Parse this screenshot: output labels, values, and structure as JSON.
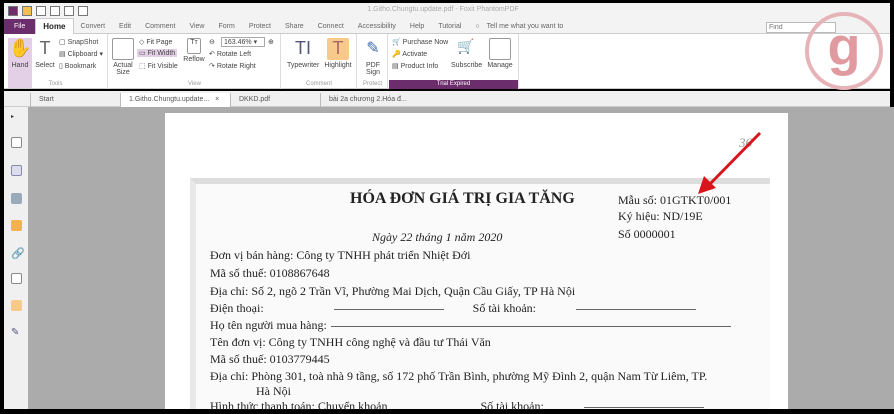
{
  "window": {
    "title": "1.Githo.Chungtu.update.pdf - Foxit PhantomPDF"
  },
  "menu": [
    "File",
    "Home",
    "Convert",
    "Edit",
    "Comment",
    "View",
    "Form",
    "Protect",
    "Share",
    "Connect",
    "Accessibility",
    "Help",
    "Tutorial"
  ],
  "tell_me": "Tell me what you want to",
  "find_placeholder": "Find",
  "ribbon": {
    "tools": {
      "hand": "Hand",
      "select": "Select",
      "snapshot": "SnapShot",
      "clipboard": "Clipboard",
      "bookmark": "Bookmark",
      "label": "Tools"
    },
    "view": {
      "actual_size": "Actual Size",
      "fit_page": "Fit Page",
      "fit_width": "Fit Width",
      "fit_visible": "Fit Visible",
      "reflow": "Reflow",
      "zoom": "163.46%",
      "rotate_left": "Rotate Left",
      "rotate_right": "Rotate Right",
      "label": "View"
    },
    "comment": {
      "typewriter": "Typewriter",
      "highlight": "Highlight",
      "label": "Comment"
    },
    "protect": {
      "pdf_sign": "PDF Sign",
      "label": "Protect"
    },
    "trial": {
      "purchase": "Purchase Now",
      "activate": "Activate",
      "product_info": "Product Info",
      "subscribe": "Subscribe",
      "manage": "Manage",
      "label": "Trial Expired"
    }
  },
  "tabs": [
    "Start",
    "1.Githo.Chungtu.update...",
    "DKKD.pdf",
    "bài 2a chương 2.Hóa đ..."
  ],
  "doc": {
    "page_mark": "36",
    "title": "HÓA ĐƠN GIÁ TRỊ GIA TĂNG",
    "mau_so": "Mẫu số: 01GTKT0/001",
    "ky_hieu": "Ký hiệu:  ND/19E",
    "so": "Số  0000001",
    "date": "Ngày   22  tháng   1   năm   2020",
    "lines": [
      "Đơn vị bán hàng:  Công ty TNHH phát triển Nhiệt Đới",
      "Mã số thuế:  0108867648",
      "Địa chỉ: Số 2, ngõ 2 Trần Vĩ, Phường Mai Dịch, Quận Cầu Giấy, TP Hà Nội",
      "Điện thoại:",
      "Họ tên người mua hàng:",
      "Tên đơn vị:  Công ty TNHH công nghệ và đầu tư Thái Văn",
      "Mã số thuế:  0103779445",
      "Địa chỉ: Phòng 301, toà nhà 9 tầng, số 172 phố Trần Bình, phường Mỹ Đình 2, quận Nam Từ Liêm, TP.",
      "Hà Nội",
      "Hình thức thanh toán:  Chuyển khoản"
    ],
    "so_tai_khoan": "Số tài khoản:"
  },
  "colors": {
    "accent": "#6b2d6b",
    "arrow": "#d8141c"
  }
}
